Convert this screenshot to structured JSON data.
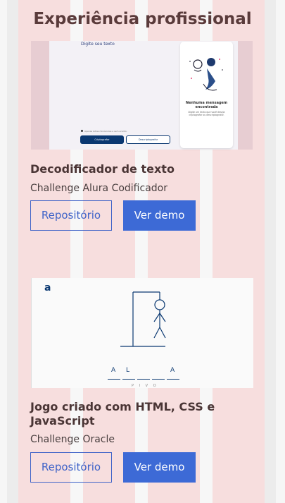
{
  "section": {
    "title": "Experiência profissional"
  },
  "projects": [
    {
      "preview": {
        "input_placeholder": "Digite seu texto",
        "panel_title": "Nenhuma mensagem encontrada",
        "panel_text": "Digite um texto que você deseja criptografar ou descriptografar.",
        "warning": "Apenas letras minúsculas e sem acento.",
        "encrypt_label": "Criptografar",
        "decrypt_label": "Descriptografar"
      },
      "title": "Decodificador de texto",
      "subtitle": "Challenge Alura Codificador",
      "repo_label": "Repositório",
      "demo_label": "Ver demo"
    },
    {
      "preview": {
        "logo": "a",
        "guessed_letters": [
          "A",
          "L",
          "",
          "",
          "A"
        ],
        "wrong_letters": "P I V O"
      },
      "title": "Jogo criado com HTML, CSS e JavaScript",
      "subtitle": "Challenge Oracle",
      "repo_label": "Repositório",
      "demo_label": "Ver demo"
    }
  ],
  "colors": {
    "accent": "#3d6ad6",
    "title": "#5a3b3b",
    "panel_bg": "#f7dede",
    "dark_blue": "#0a3871"
  }
}
